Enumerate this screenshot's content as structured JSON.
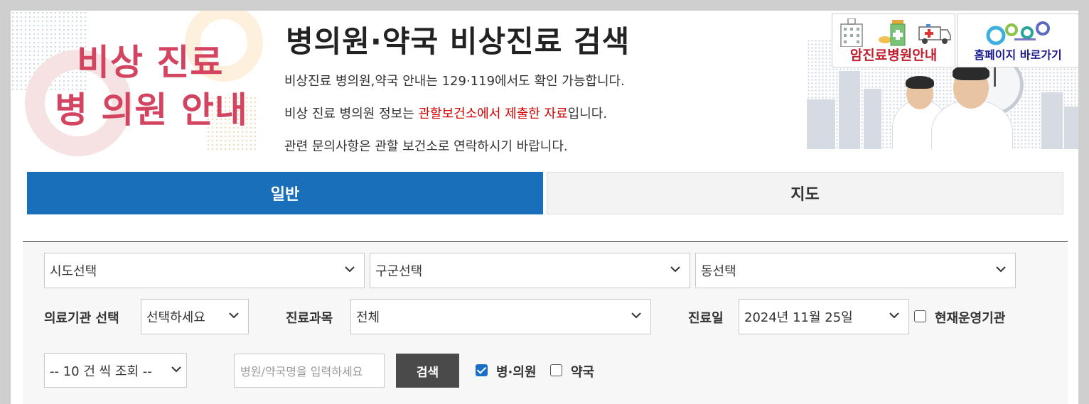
{
  "banner": {
    "left_line1": "비상 진료",
    "left_line2": "병 의원 안내",
    "title": "병의원·약국 비상진료 검색",
    "info1": "비상진료 병의원,약국 안내는 129·119에서도 확인 가능합니다.",
    "info2_pre": "비상 진료 병의원 정보는 ",
    "info2_red": "관할보건소에서 제출한 자료",
    "info2_post": "입니다.",
    "info3": "관련 문의사항은 관할 보건소로 연락하시기 바랍니다.",
    "cancer_button": "암진료병원안내",
    "home_button": "홈페이지 바로가기",
    "colors": {
      "pink_title": "#d2445f",
      "red_note": "#d40000",
      "cancer_red": "#c01f2f",
      "home_navy": "#1b1b8f"
    }
  },
  "tabs": [
    {
      "label": "일반",
      "active": true
    },
    {
      "label": "지도",
      "active": false
    }
  ],
  "colors": {
    "active_tab": "#1a6fba",
    "search_button": "#4a4a4a",
    "checkbox_on": "#1a6fc4"
  },
  "filters": {
    "sido": "시도선택",
    "gugun": "구군선택",
    "dong": "동선택",
    "institution_label": "의료기관 선택",
    "institution_value": "선택하세요",
    "department_label": "진료과목",
    "department_value": "전체",
    "date_label": "진료일",
    "date_value": "2024년 11월 25일",
    "operating_label": "현재운영기관",
    "operating_checked": false,
    "page_size": "-- 10 건 씩 조회 --",
    "name_placeholder": "병원/약국명을 입력하세요",
    "search_button": "검색",
    "hospital_label": "병·의원",
    "hospital_checked": true,
    "pharmacy_label": "약국",
    "pharmacy_checked": false
  },
  "icons": [
    "chevron-down-icon",
    "hospital-building-icon",
    "medicine-bottle-icon",
    "ambulance-icon",
    "gg-logo-icon"
  ]
}
